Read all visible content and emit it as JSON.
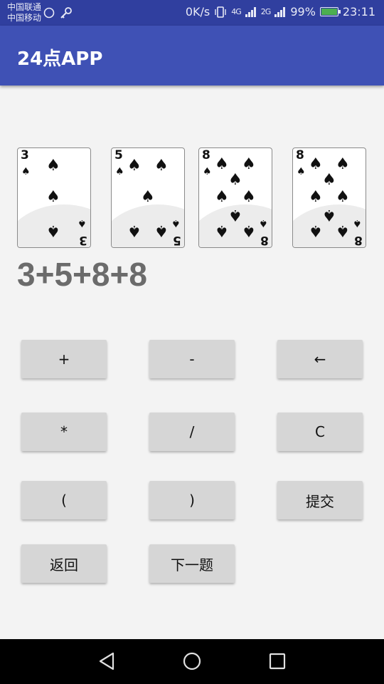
{
  "status_bar": {
    "carrier1": "中国联通",
    "carrier2": "中国移动",
    "speed": "0K/s",
    "net1": "4G",
    "net2": "2G",
    "battery": "99%",
    "time": "23:11"
  },
  "app_bar": {
    "title": "24点APP"
  },
  "cards": [
    {
      "rank": "3",
      "suit": "spade"
    },
    {
      "rank": "5",
      "suit": "spade"
    },
    {
      "rank": "8",
      "suit": "spade"
    },
    {
      "rank": "8",
      "suit": "spade"
    }
  ],
  "expression": "3+5+8+8",
  "buttons": {
    "plus": "+",
    "minus": "-",
    "backspace": "←",
    "multiply": "*",
    "divide": "/",
    "clear": "C",
    "lparen": "(",
    "rparen": ")",
    "submit": "提交",
    "back": "返回",
    "next": "下一题"
  },
  "colors": {
    "status_bar": "#303F9F",
    "app_bar": "#3F51B5",
    "button": "#d6d6d6",
    "expression": "#6b6b6b"
  },
  "nav_icons": [
    "back-triangle-icon",
    "home-circle-icon",
    "recents-square-icon"
  ]
}
